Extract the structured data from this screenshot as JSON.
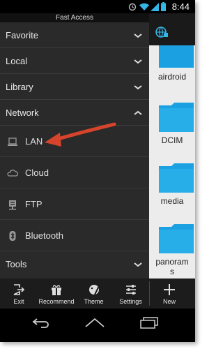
{
  "status_bar": {
    "time": "8:44"
  },
  "drawer": {
    "title": "Fast Access",
    "sections": [
      {
        "label": "Favorite"
      },
      {
        "label": "Local"
      },
      {
        "label": "Library"
      },
      {
        "label": "Network"
      }
    ],
    "network_items": [
      {
        "label": "LAN",
        "icon": "laptop-icon"
      },
      {
        "label": "Cloud",
        "icon": "cloud-icon"
      },
      {
        "label": "FTP",
        "icon": "ftp-server-icon"
      },
      {
        "label": "Bluetooth",
        "icon": "bluetooth-icon"
      }
    ],
    "tools": {
      "label": "Tools"
    }
  },
  "background_app": {
    "folders": [
      {
        "label": "airdroid"
      },
      {
        "label": "DCIM"
      },
      {
        "label": "media"
      },
      {
        "label_line1": "panoram",
        "label_line2": "s"
      }
    ]
  },
  "toolbar": {
    "exit_label": "Exit",
    "recommend_label": "Recommend",
    "theme_label": "Theme",
    "settings_label": "Settings",
    "new_label": "New"
  },
  "colors": {
    "drawer_bg": "#2a2a2a",
    "folder_blue": "#1ba1e2",
    "annotation_arrow": "#d6452b"
  }
}
